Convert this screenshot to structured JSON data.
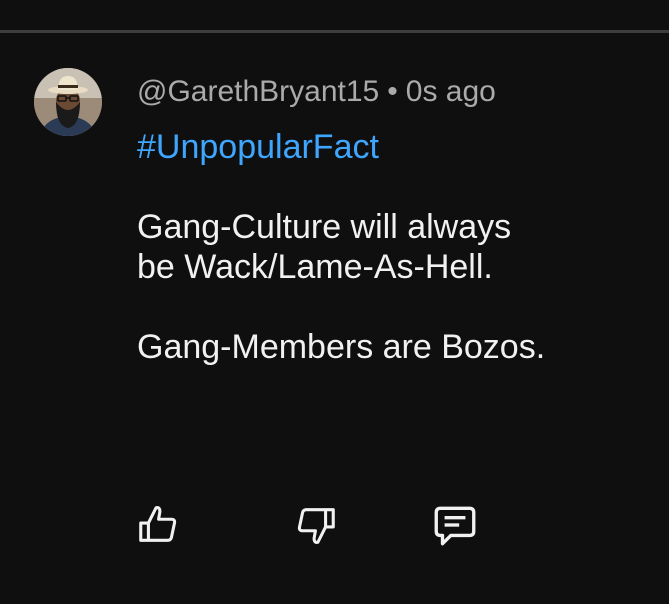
{
  "comment": {
    "author_handle": "@GarethBryant15",
    "separator": "•",
    "timestamp": "0s ago",
    "hashtag": "#UnpopularFact",
    "lines": [
      "Gang-Culture will always",
      "be Wack/Lame-As-Hell.",
      "",
      "Gang-Members are Bozos."
    ]
  },
  "actions": {
    "like_icon": "thumbs-up-icon",
    "dislike_icon": "thumbs-down-icon",
    "reply_icon": "comment-icon"
  },
  "colors": {
    "background": "#0f0f0f",
    "text": "#f1f1f1",
    "meta_text": "#aaaaaa",
    "hashtag": "#3ea6ff",
    "divider": "#3d3d3d"
  }
}
